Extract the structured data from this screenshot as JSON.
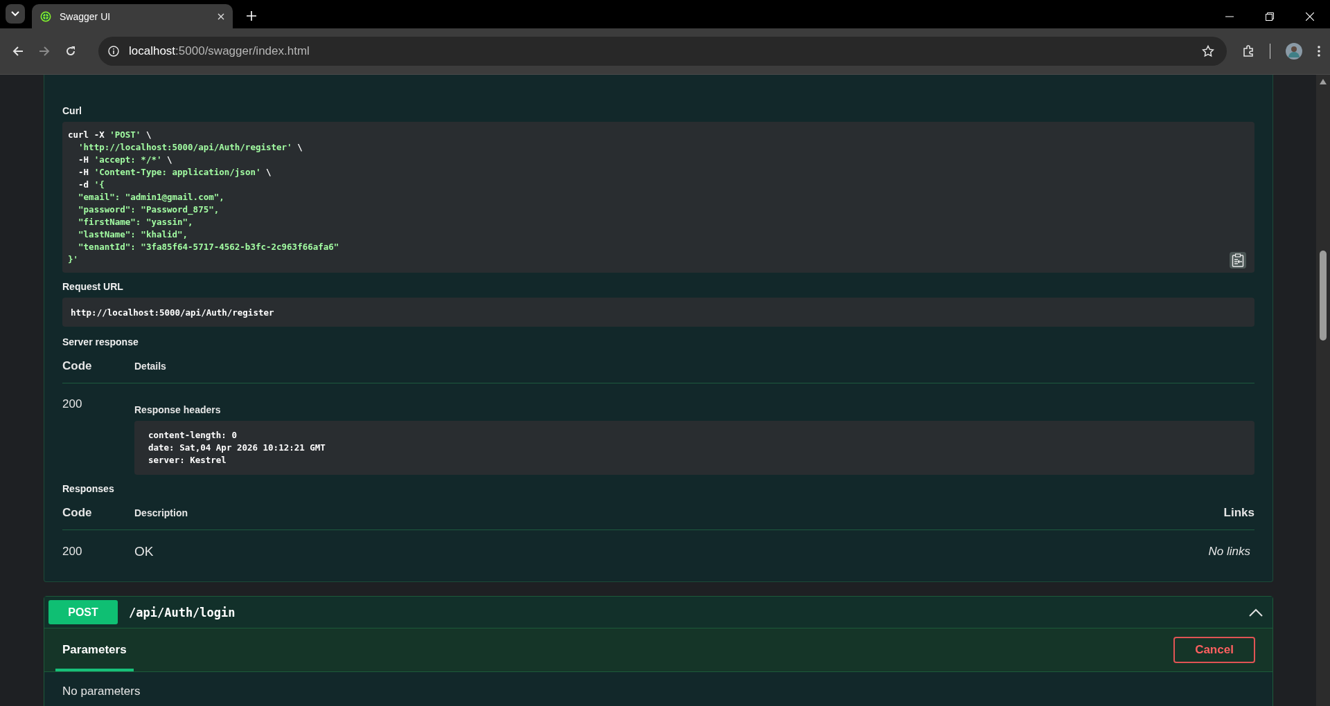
{
  "browser": {
    "tab_title": "Swagger UI",
    "url_host": "localhost",
    "url_path": ":5000/swagger/index.html"
  },
  "curl": {
    "label": "Curl",
    "lines": [
      [
        {
          "kind": "plain",
          "text": "curl -X "
        },
        {
          "kind": "string",
          "text": "'POST'"
        },
        {
          "kind": "plain",
          "text": " \\"
        }
      ],
      [
        {
          "kind": "string",
          "text": "  'http://localhost:5000/api/Auth/register'"
        },
        {
          "kind": "plain",
          "text": " \\"
        }
      ],
      [
        {
          "kind": "plain",
          "text": "  -H "
        },
        {
          "kind": "string",
          "text": "'accept: */*'"
        },
        {
          "kind": "plain",
          "text": " \\"
        }
      ],
      [
        {
          "kind": "plain",
          "text": "  -H "
        },
        {
          "kind": "string",
          "text": "'Content-Type: application/json'"
        },
        {
          "kind": "plain",
          "text": " \\"
        }
      ],
      [
        {
          "kind": "plain",
          "text": "  -d "
        },
        {
          "kind": "string",
          "text": "'{"
        }
      ],
      [
        {
          "kind": "string",
          "text": "  \"email\": \"admin1@gmail.com\","
        }
      ],
      [
        {
          "kind": "string",
          "text": "  \"password\": \"Password_875\","
        }
      ],
      [
        {
          "kind": "string",
          "text": "  \"firstName\": \"yassin\","
        }
      ],
      [
        {
          "kind": "string",
          "text": "  \"lastName\": \"khalid\","
        }
      ],
      [
        {
          "kind": "string",
          "text": "  \"tenantId\": \"3fa85f64-5717-4562-b3fc-2c963f66afa6\""
        }
      ],
      [
        {
          "kind": "string",
          "text": "}'"
        }
      ]
    ]
  },
  "request_url": {
    "label": "Request URL",
    "value": "http://localhost:5000/api/Auth/register"
  },
  "server_response": {
    "label": "Server response",
    "columns": [
      "Code",
      "Details"
    ],
    "code": "200",
    "headers_label": "Response headers",
    "headers": [
      "content-length: 0",
      "date: Sat,04 Apr 2026 10:12:21 GMT",
      "server: Kestrel"
    ]
  },
  "responses": {
    "label": "Responses",
    "columns": [
      "Code",
      "Description",
      "Links"
    ],
    "rows": [
      {
        "code": "200",
        "description": "OK",
        "links": "No links"
      }
    ]
  },
  "operation": {
    "method": "POST",
    "path": "/api/Auth/login",
    "expanded": true,
    "tabs": [
      {
        "label": "Parameters",
        "selected": true
      }
    ],
    "cancel": "Cancel",
    "body": "No parameters"
  }
}
